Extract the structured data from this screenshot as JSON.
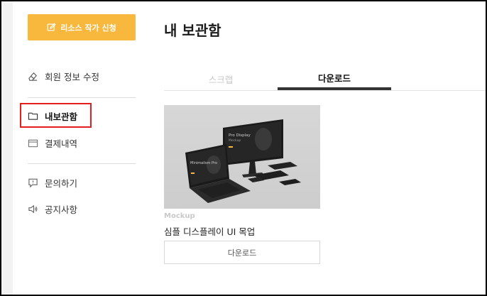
{
  "sidebar": {
    "apply_button_label": "리소스 작가 신청",
    "items": [
      {
        "label": "회원 정보 수정",
        "icon": "eraser-icon"
      },
      {
        "label": "내보관함",
        "icon": "folder-icon"
      },
      {
        "label": "결제내역",
        "icon": "wallet-icon"
      },
      {
        "label": "문의하기",
        "icon": "speech-alert-icon"
      },
      {
        "label": "공지사항",
        "icon": "megaphone-icon"
      }
    ],
    "active_item": "내보관함"
  },
  "main": {
    "title": "내 보관함",
    "tabs": [
      {
        "label": "스크랩",
        "active": false
      },
      {
        "label": "다운로드",
        "active": true
      }
    ],
    "card": {
      "category": "Mockup",
      "title": "심플 디스플레이 UI 목업",
      "download_label": "다운로드",
      "image_text": {
        "laptop": "Minimalism Pro",
        "monitor": "Pro Display",
        "monitor_sub": "Mockup"
      }
    }
  },
  "colors": {
    "accent": "#f8b73d",
    "highlight_box": "#e41e1e",
    "active_tab_underline": "#333333"
  }
}
